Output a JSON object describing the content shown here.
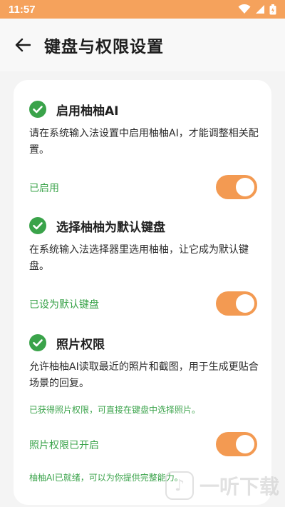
{
  "status_bar": {
    "time": "11:57"
  },
  "header": {
    "title": "键盘与权限设置"
  },
  "colors": {
    "accent": "#f39a52",
    "success": "#3aa34a",
    "status_bar": "#f5a25c"
  },
  "sections": [
    {
      "title": "启用柚柚AI",
      "description": "请在系统输入法设置中启用柚柚AI，才能调整相关配置。",
      "status": "已启用",
      "toggle_on": true
    },
    {
      "title": "选择柚柚为默认键盘",
      "description": "在系统输入法选择器里选用柚柚，让它成为默认键盘。",
      "status": "已设为默认键盘",
      "toggle_on": true
    },
    {
      "title": "照片权限",
      "description": "允许柚柚AI读取最近的照片和截图，用于生成更贴合场景的回复。",
      "note": "已获得照片权限，可直接在键盘中选择照片。",
      "status": "照片权限已开启",
      "toggle_on": true
    }
  ],
  "footer_note": "柚柚AI已就绪，可以为你提供完整能力。",
  "watermark": {
    "text": "一听下载"
  }
}
